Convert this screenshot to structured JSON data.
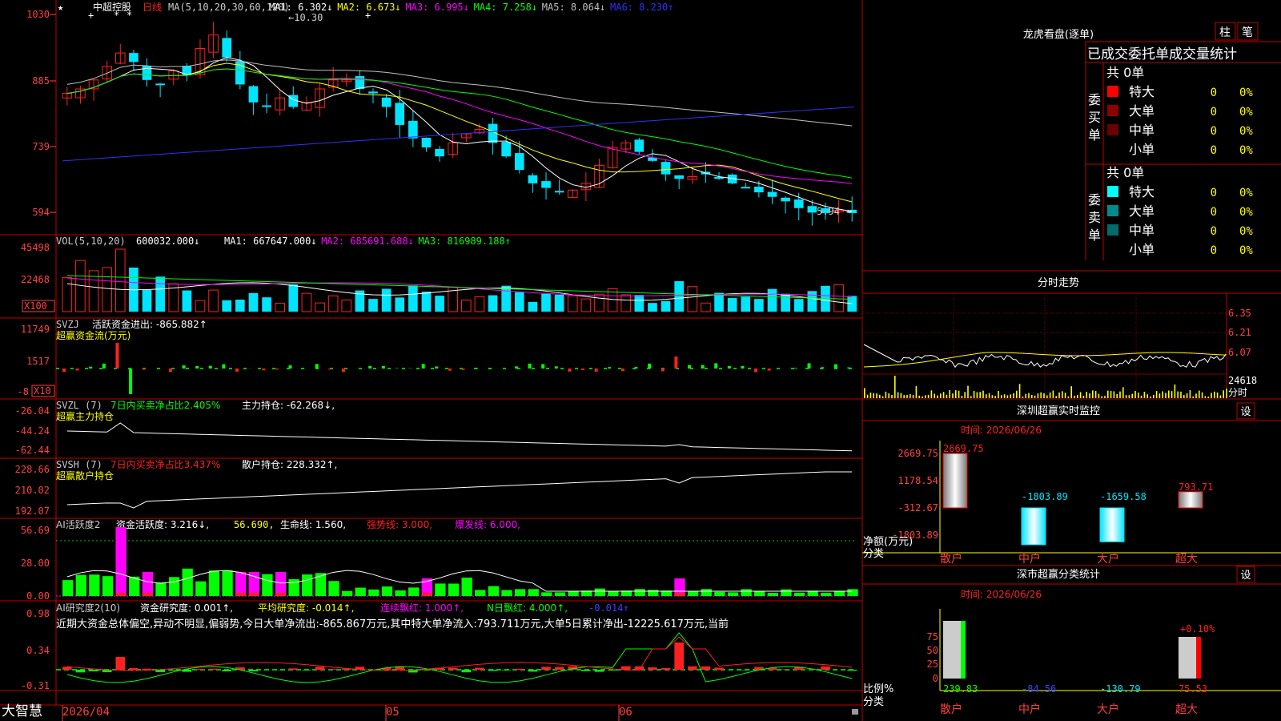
{
  "colors": {
    "up": "#ff2020",
    "down": "#00e5ff",
    "green": "#00ff00",
    "grid": "#c00000",
    "axis": "#ff4040",
    "white": "#ffffff",
    "yellow": "#ffff00",
    "magenta": "#ff00ff"
  },
  "main": {
    "title": "中超控股",
    "period": "日线",
    "ma_label": "MA(5,10,20,30,60,120)",
    "ma_items": [
      {
        "label": "MA1:",
        "value": "6.302",
        "arrow": "↓",
        "color": "#ffffff"
      },
      {
        "label": "MA2:",
        "value": "6.673",
        "arrow": "↓",
        "color": "#ffff00"
      },
      {
        "label": "MA3:",
        "value": "6.995",
        "arrow": "↓",
        "color": "#ff00ff"
      },
      {
        "label": "MA4:",
        "value": "7.258",
        "arrow": "↓",
        "color": "#00ff00"
      },
      {
        "label": "MA5:",
        "value": "8.064",
        "arrow": "↓",
        "color": "#c0c0c0"
      },
      {
        "label": "MA6:",
        "value": "8.230",
        "arrow": "↑",
        "color": "#3030ff"
      }
    ],
    "high_mark": "10.30",
    "low_mark": "5.94",
    "y_ticks": [
      "1030",
      "885",
      "739",
      "594"
    ],
    "markers": [
      "★",
      "+",
      "*",
      "*",
      "+"
    ]
  },
  "vol": {
    "label": "VOL(5,10,20)",
    "value": "600032.000",
    "items": [
      {
        "label": "MA1:",
        "value": "667647.000",
        "arrow": "↓",
        "color": "#ffffff"
      },
      {
        "label": "MA2:",
        "value": "685691.688",
        "arrow": "↓",
        "color": "#ff00ff"
      },
      {
        "label": "MA3:",
        "value": "816989.188",
        "arrow": "↑",
        "color": "#00ff00"
      }
    ],
    "y_ticks": [
      "45498",
      "22468"
    ],
    "unit": "X100"
  },
  "svzj": {
    "label": "SVZJ",
    "text": "活跃资金进出:",
    "value": "-865.882",
    "arrow": "↑",
    "subtitle": "超赢资金流(万元)",
    "y_ticks": [
      "11749",
      "1517",
      "-8"
    ],
    "unit": "X10"
  },
  "svzl": {
    "label": "SVZL (7)",
    "text": "7日内买卖净占比2.405%",
    "text2": "主力持仓:",
    "value": "-62.268",
    "arrow": "↓",
    "subtitle": "超赢主力持仓",
    "y_ticks": [
      "-26.04",
      "-44.24",
      "-62.44"
    ]
  },
  "svsh": {
    "label": "SVSH (7)",
    "text": "7日内买卖净占比3.437%",
    "text2": "散户持仓:",
    "value": "228.332",
    "arrow": "↑",
    "subtitle": "超赢散户持仓",
    "y_ticks": [
      "228.66",
      "210.02",
      "192.07"
    ]
  },
  "ai1": {
    "label": "AI活跃度2",
    "t1": "资金活跃度:",
    "v1": "3.216",
    "a1": "↓",
    "v2": "56.690",
    "t3": "生命线:",
    "v3": "1.560",
    "t4": "强势线:",
    "v4": "3.000",
    "t5": "爆发线:",
    "v5": "6.000",
    "y_ticks": [
      "56.69",
      "28.00",
      "0.00"
    ]
  },
  "ai2": {
    "label": "AI研究度2(10)",
    "t1": "资金研究度:",
    "v1": "0.001",
    "a1": "↑",
    "t2": "平均研究度:",
    "v2": "-0.014",
    "a2": "↑",
    "t3": "连续飘红:",
    "v3": "1.000",
    "a3": "↑",
    "t4": "N日飘红:",
    "v4": "4.000",
    "a4": "↑",
    "v5": "-0.014",
    "a5": "↑",
    "comment": "近期大资金总体偏空,异动不明显,偏弱势,今日大单净流出:-865.867万元,其中特大单净流入:793.711万元,大单5日累计净出-12225.617万元,当前",
    "y_ticks": [
      "0.98",
      "0.34",
      "-0.31"
    ]
  },
  "xaxis": {
    "labels": [
      "2026/04",
      "05",
      "06"
    ],
    "brand": "大智慧"
  },
  "lhb": {
    "title": "龙虎看盘(逐单)",
    "btn1": "柱",
    "btn2": "笔",
    "header": "已成交委托单成交量统计",
    "buy_side": "委买单",
    "sell_side": "委卖单",
    "buy_total": "共 0单",
    "sell_total": "共 0单",
    "rows": [
      {
        "name": "特大",
        "count": "0",
        "pct": "0%"
      },
      {
        "name": "大单",
        "count": "0",
        "pct": "0%"
      },
      {
        "name": "中单",
        "count": "0",
        "pct": "0%"
      },
      {
        "name": "小单",
        "count": "0",
        "pct": "0%"
      }
    ]
  },
  "fenshi": {
    "title": "分时走势",
    "y_ticks": [
      "6.35",
      "6.21",
      "6.07"
    ],
    "vol_tick": "24618",
    "unit": "分时"
  },
  "monitor": {
    "title": "深圳超赢实时监控",
    "btn": "设",
    "time": "时间: 2026/06/26",
    "y_ticks": [
      "2669.75",
      "1178.54",
      "-312.67",
      "-1803.89"
    ],
    "unit_top": "净额(万元)",
    "unit_bot": "分类",
    "cats": [
      "散户",
      "中户",
      "大户",
      "超大"
    ],
    "values": [
      2669.75,
      -1803.89,
      -1659.58,
      793.71
    ],
    "value_labels": [
      "2669.75",
      "-1803.89",
      "-1659.58",
      "793.71"
    ]
  },
  "classify": {
    "title": "深市超赢分类统计",
    "btn": "设",
    "time": "时间: 2026/06/26",
    "y_ticks": [
      "75",
      "50",
      "25",
      "0"
    ],
    "unit_top": "比例%",
    "unit_bot": "分类",
    "cats": [
      "散户",
      "中户",
      "大户",
      "超大"
    ],
    "bottom_values": [
      "239.83",
      "-84.56",
      "-130.79",
      "75.53"
    ],
    "top_label": "+0.10%"
  }
}
